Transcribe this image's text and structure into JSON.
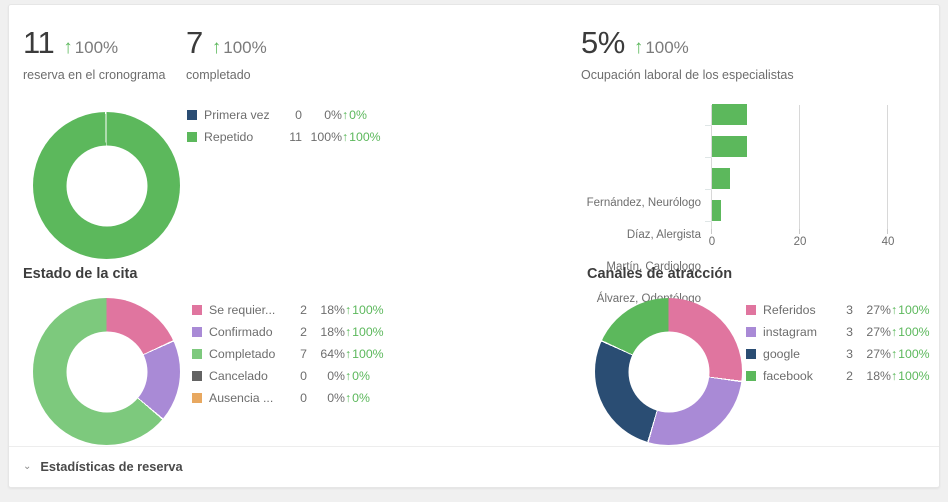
{
  "kpis": [
    {
      "value": "11",
      "arrow": "↑",
      "delta": "100%",
      "label": "reserva en el cronograma"
    },
    {
      "value": "7",
      "arrow": "↑",
      "delta": "100%",
      "label": "completado"
    },
    {
      "value": "5%",
      "arrow": "↑",
      "delta": "100%",
      "label": "Ocupación laboral de los especialistas"
    }
  ],
  "visit_type": {
    "legend": [
      {
        "name": "Primera vez",
        "count": "0",
        "pct": "0%",
        "trend": "0%",
        "arrow": "↑",
        "color": "#2a4d73"
      },
      {
        "name": "Repetido",
        "count": "11",
        "pct": "100%",
        "trend": "100%",
        "arrow": "↑",
        "color": "#5cb85c"
      }
    ]
  },
  "appointment_status": {
    "title": "Estado de la cita",
    "legend": [
      {
        "name": "Se requier...",
        "count": "2",
        "pct": "18%",
        "trend": "100%",
        "arrow": "↑",
        "color": "#e0759f"
      },
      {
        "name": "Confirmado",
        "count": "2",
        "pct": "18%",
        "trend": "100%",
        "arrow": "↑",
        "color": "#a98ad6"
      },
      {
        "name": "Completado",
        "count": "7",
        "pct": "64%",
        "trend": "100%",
        "arrow": "↑",
        "color": "#7dc97d"
      },
      {
        "name": "Cancelado",
        "count": "0",
        "pct": "0%",
        "trend": "0%",
        "arrow": "↑",
        "color": "#636363"
      },
      {
        "name": "Ausencia ...",
        "count": "0",
        "pct": "0%",
        "trend": "0%",
        "arrow": "↑",
        "color": "#e8a860"
      }
    ]
  },
  "acquisition_channels": {
    "title": "Canales de atracción",
    "legend": [
      {
        "name": "Referidos",
        "count": "3",
        "pct": "27%",
        "trend": "100%",
        "arrow": "↑",
        "color": "#e0759f"
      },
      {
        "name": "instagram",
        "count": "3",
        "pct": "27%",
        "trend": "100%",
        "arrow": "↑",
        "color": "#a98ad6"
      },
      {
        "name": "google",
        "count": "3",
        "pct": "27%",
        "trend": "100%",
        "arrow": "↑",
        "color": "#2a4d73"
      },
      {
        "name": "facebook",
        "count": "2",
        "pct": "18%",
        "trend": "100%",
        "arrow": "↑",
        "color": "#5cb85c"
      }
    ]
  },
  "footer": {
    "chevron": "⌄",
    "label": "Estadísticas de reserva"
  },
  "colors": {
    "green": "#5cb85c",
    "pink": "#e0759f",
    "purple": "#a98ad6",
    "navy": "#2a4d73",
    "gray": "#636363",
    "orange": "#e8a860",
    "light_green": "#7dc97d"
  },
  "chart_data": [
    {
      "type": "bar",
      "orientation": "horizontal",
      "title": "Ocupación laboral de los especialistas",
      "categories": [
        "Fernández, Neurólogo",
        "Díaz, Alergista",
        "Martín, Cardiologo",
        "Álvarez, Odontólogo"
      ],
      "values": [
        8,
        8,
        4,
        2
      ],
      "xlabel": "",
      "ylabel": "",
      "xlim": [
        0,
        48
      ],
      "xticks": [
        "0",
        "20",
        "40"
      ],
      "xtick_values": [
        0,
        20,
        40
      ],
      "grid": true,
      "legend": "none",
      "color": "#5cb85c"
    },
    {
      "type": "pie",
      "subtype": "donut",
      "title": "",
      "labels": [
        "Primera vez",
        "Repetido"
      ],
      "values": [
        0,
        11
      ],
      "percents": [
        0,
        100
      ],
      "colors": [
        "#2a4d73",
        "#5cb85c"
      ],
      "legend": "right"
    },
    {
      "type": "pie",
      "subtype": "donut",
      "title": "Estado de la cita",
      "labels": [
        "Se requier...",
        "Confirmado",
        "Completado",
        "Cancelado",
        "Ausencia ..."
      ],
      "values": [
        2,
        2,
        7,
        0,
        0
      ],
      "percents": [
        18,
        18,
        64,
        0,
        0
      ],
      "colors": [
        "#e0759f",
        "#a98ad6",
        "#7dc97d",
        "#636363",
        "#e8a860"
      ],
      "legend": "right"
    },
    {
      "type": "pie",
      "subtype": "donut",
      "title": "Canales de atracción",
      "labels": [
        "Referidos",
        "instagram",
        "google",
        "facebook"
      ],
      "values": [
        3,
        3,
        3,
        2
      ],
      "percents": [
        27,
        27,
        27,
        18
      ],
      "colors": [
        "#e0759f",
        "#a98ad6",
        "#2a4d73",
        "#5cb85c"
      ],
      "legend": "right"
    }
  ]
}
